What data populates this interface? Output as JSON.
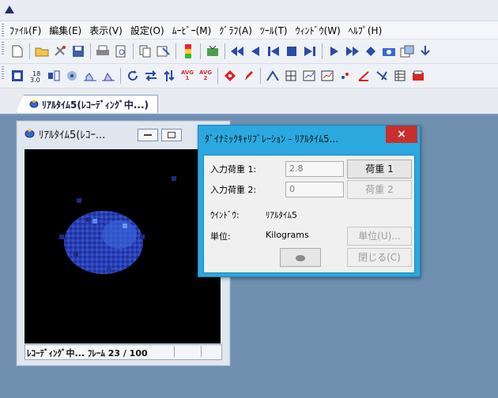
{
  "window": {
    "app_icon": "app-triangle-icon"
  },
  "menu": {
    "items": [
      "ﾌｧｲﾙ(F)",
      "編集(E)",
      "表示(V)",
      "設定(O)",
      "ﾑｰﾋﾞｰ(M)",
      "ｸﾞﾗﾌ(A)",
      "ﾂｰﾙ(T)",
      "ｳｨﾝﾄﾞｳ(W)",
      "ﾍﾙﾌﾟ(H)"
    ]
  },
  "toolbar1": {
    "groups": [
      [
        "new-file-icon",
        "open-folder-icon",
        "settings-icon",
        "save-icon"
      ],
      [
        "print-icon",
        "print-preview-icon"
      ],
      [
        "copy-icon",
        "paste-special-icon"
      ],
      [
        "color-palette-icon"
      ],
      [
        "capture-icon"
      ],
      [
        "rewind-icon",
        "step-back-icon",
        "first-frame-icon",
        "stop-icon",
        "last-frame-icon"
      ],
      [
        "play-icon",
        "fast-forward-icon",
        "diamond-icon",
        "camera-icon",
        "copy-image-icon",
        "download-icon"
      ]
    ]
  },
  "toolbar2": {
    "avg_label": "AVG"
  },
  "tab": {
    "label": "ﾘｱﾙﾀｲﾑ5(ﾚｺｰﾃﾞｨﾝｸﾞ中...)"
  },
  "child_window": {
    "title": "ﾘｱﾙﾀｲﾑ5(ﾚｺｰ...",
    "status": "ﾚｺｰﾃﾞｨﾝｸﾞ中... ﾌﾚｰﾑ 23 / 100"
  },
  "dialog": {
    "title": "ﾀﾞｲﾅﾐｯｸｷｬﾘﾌﾞﾚｰｼｮﾝ - ﾘｱﾙﾀｲﾑ5...",
    "close_glyph": "×",
    "load1_label": "入力荷重 1:",
    "load1_value": "2.8",
    "load2_label": "入力荷重 2:",
    "load2_value": "0",
    "window_label": "ｳｲﾝﾄﾞｳ:",
    "window_value": "ﾘｱﾙﾀｲﾑ5",
    "unit_label": "単位:",
    "unit_value": "Kilograms",
    "btn_load1": "荷重 1",
    "btn_load2": "荷重 2",
    "btn_unit": "単位(U)...",
    "btn_close": "閉じる(C)"
  },
  "colors": {
    "dialog_frame": "#2ba8de",
    "close_button": "#c9302c",
    "mdi_background": "#6e8fae",
    "pressure_high": "#3a63d8",
    "pressure_low": "#1b2a8a"
  }
}
